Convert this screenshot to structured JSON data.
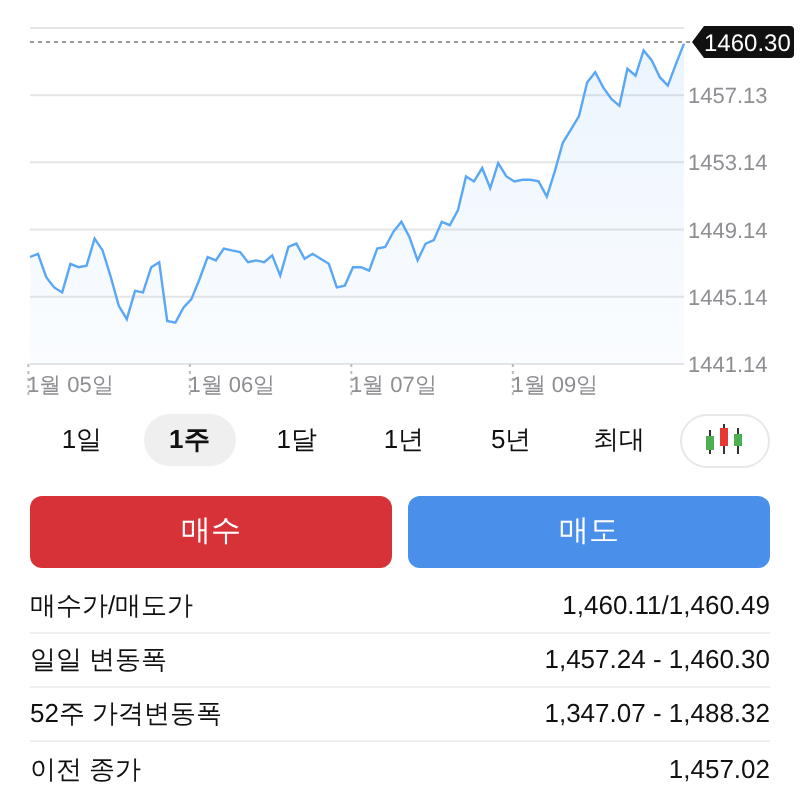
{
  "chart_data": {
    "type": "area",
    "grid": true,
    "categories": [
      null,
      null,
      null,
      null,
      null,
      "1월 05일",
      null,
      null,
      null,
      null,
      null,
      null,
      null,
      null,
      null,
      null,
      null,
      null,
      null,
      null,
      null,
      null,
      null,
      null,
      null,
      "1월 06일",
      null,
      null,
      null,
      null,
      null,
      null,
      null,
      null,
      null,
      null,
      null,
      null,
      null,
      null,
      null,
      null,
      null,
      null,
      null,
      "1월 07일",
      null,
      null,
      null,
      null,
      null,
      null,
      null,
      null,
      null,
      null,
      null,
      null,
      null,
      null,
      null,
      null,
      null,
      null,
      null,
      "1월 09일",
      null,
      null,
      null,
      null,
      null,
      null,
      null,
      null,
      null,
      null,
      null,
      null,
      null,
      null,
      null,
      null
    ],
    "series": [
      {
        "color": "#5aa7f5",
        "values": [
          1447.5,
          1447.7,
          1446.3,
          1445.7,
          1445.4,
          1447.1,
          1446.9,
          1447.0,
          1448.6,
          1447.9,
          1446.3,
          1444.6,
          1443.8,
          1445.5,
          1445.4,
          1446.9,
          1447.2,
          1443.7,
          1443.6,
          1444.5,
          1445.0,
          1446.2,
          1447.5,
          1447.3,
          1448.0,
          1447.9,
          1447.8,
          1447.2,
          1447.3,
          1447.2,
          1447.6,
          1446.4,
          1448.1,
          1448.3,
          1447.4,
          1447.7,
          1447.4,
          1447.1,
          1445.7,
          1445.8,
          1446.9,
          1446.9,
          1446.7,
          1448.0,
          1448.1,
          1449.0,
          1449.6,
          1448.7,
          1447.3,
          1448.3,
          1448.5,
          1449.6,
          1449.4,
          1450.3,
          1452.3,
          1452.0,
          1452.8,
          1451.6,
          1453.1,
          1452.3,
          1452.0,
          1452.1,
          1452.1,
          1452.0,
          1451.1,
          1452.6,
          1454.3,
          1455.1,
          1455.9,
          1457.9,
          1458.5,
          1457.6,
          1456.9,
          1456.5,
          1458.7,
          1458.3,
          1459.8,
          1459.2,
          1458.2,
          1457.7,
          1459.0,
          1460.2
        ]
      }
    ],
    "ylim": [
      1441.14,
      1461.13
    ],
    "yticks": [
      1441.14,
      1445.14,
      1449.14,
      1453.14,
      1457.13
    ],
    "ref_lines": [
      {
        "axis": "y",
        "color": "#9a9a9a",
        "value": 1460.3,
        "label": "1460.30"
      }
    ]
  },
  "ranges": [
    {
      "label": "1일",
      "selected": false
    },
    {
      "label": "1주",
      "selected": true
    },
    {
      "label": "1달",
      "selected": false
    },
    {
      "label": "1년",
      "selected": false
    },
    {
      "label": "5년",
      "selected": false
    },
    {
      "label": "최대",
      "selected": false
    }
  ],
  "buttons": [
    {
      "kind": "buy",
      "label": "매수"
    },
    {
      "kind": "sell",
      "label": "매도"
    }
  ],
  "stats": [
    {
      "label": "매수가/매도가",
      "value": "1,460.11/1,460.49"
    },
    {
      "label": "일일 변동폭",
      "value": "1,457.24 - 1,460.30"
    },
    {
      "label": "52주 가격변동폭",
      "value": "1,347.07 - 1,488.32"
    },
    {
      "label": "이전 종가",
      "value": "1,457.02"
    }
  ]
}
